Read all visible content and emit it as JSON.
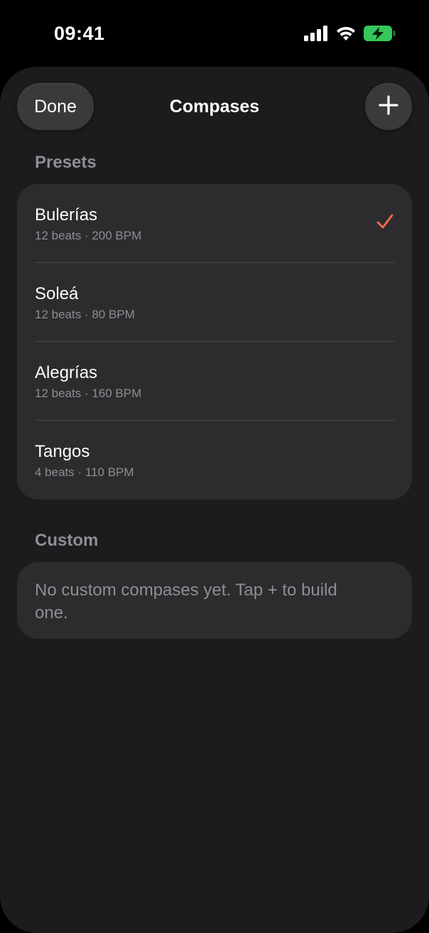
{
  "status_bar": {
    "time": "09:41",
    "icons": [
      "signal-icon",
      "wifi-icon",
      "battery-charging-icon"
    ],
    "battery_color": "#34c759"
  },
  "nav": {
    "done_label": "Done",
    "title": "Compases",
    "add_icon": "plus-icon"
  },
  "presets": {
    "header": "Presets",
    "items": [
      {
        "title": "Bulerías",
        "subtitle": "12 beats · 200 BPM",
        "selected": true
      },
      {
        "title": "Soleá",
        "subtitle": "12 beats · 80 BPM",
        "selected": false
      },
      {
        "title": "Alegrías",
        "subtitle": "12 beats · 160 BPM",
        "selected": false
      },
      {
        "title": "Tangos",
        "subtitle": "4 beats · 110 BPM",
        "selected": false
      }
    ],
    "check_color": "#ff6b4a"
  },
  "custom": {
    "header": "Custom",
    "empty_message": "No custom compases yet. Tap + to build one."
  }
}
